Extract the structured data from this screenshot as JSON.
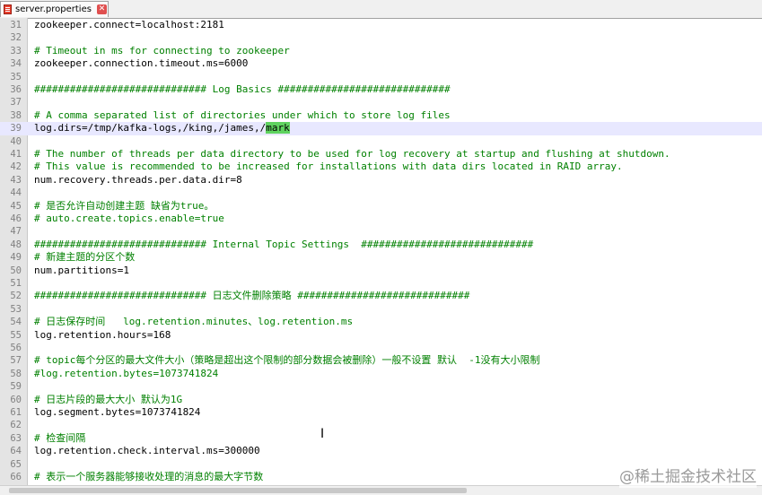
{
  "tab": {
    "title": "server.properties",
    "close_glyph": "✕"
  },
  "editor": {
    "lines": [
      {
        "n": "31",
        "parts": [
          {
            "t": "zookeeper.connect=localhost:2181"
          }
        ]
      },
      {
        "n": "32",
        "parts": []
      },
      {
        "n": "33",
        "parts": [
          {
            "t": "# Timeout in ms for connecting to zookeeper",
            "c": "comment"
          }
        ]
      },
      {
        "n": "34",
        "parts": [
          {
            "t": "zookeeper.connection.timeout.ms=6000"
          }
        ]
      },
      {
        "n": "35",
        "parts": []
      },
      {
        "n": "36",
        "parts": [
          {
            "t": "############################# Log Basics #############################",
            "c": "comment"
          }
        ]
      },
      {
        "n": "37",
        "parts": []
      },
      {
        "n": "38",
        "parts": [
          {
            "t": "# A comma separated list of directories under which to store log files",
            "c": "comment"
          }
        ]
      },
      {
        "n": "39",
        "current": true,
        "parts": [
          {
            "t": "log.dirs=/tmp/kafka-logs,/king,/james,/"
          },
          {
            "t": "mark",
            "c": "hl"
          }
        ]
      },
      {
        "n": "40",
        "parts": []
      },
      {
        "n": "41",
        "parts": [
          {
            "t": "# The number of threads per data directory to be used for log recovery at startup and flushing at shutdown.",
            "c": "comment"
          }
        ]
      },
      {
        "n": "42",
        "parts": [
          {
            "t": "# This value is recommended to be increased for installations with data dirs located in RAID array.",
            "c": "comment"
          }
        ]
      },
      {
        "n": "43",
        "parts": [
          {
            "t": "num.recovery.threads.per.data.dir=8"
          }
        ]
      },
      {
        "n": "44",
        "parts": []
      },
      {
        "n": "45",
        "parts": [
          {
            "t": "# 是否允许自动创建主题 缺省为true。",
            "c": "comment"
          }
        ]
      },
      {
        "n": "46",
        "parts": [
          {
            "t": "# auto.create.topics.enable=true",
            "c": "comment"
          }
        ]
      },
      {
        "n": "47",
        "parts": []
      },
      {
        "n": "48",
        "parts": [
          {
            "t": "############################# Internal Topic Settings  #############################",
            "c": "comment"
          }
        ]
      },
      {
        "n": "49",
        "parts": [
          {
            "t": "# 新建主题的分区个数",
            "c": "comment"
          }
        ]
      },
      {
        "n": "50",
        "parts": [
          {
            "t": "num.partitions=1"
          }
        ]
      },
      {
        "n": "51",
        "parts": []
      },
      {
        "n": "52",
        "parts": [
          {
            "t": "############################# 日志文件删除策略 #############################",
            "c": "comment"
          }
        ]
      },
      {
        "n": "53",
        "parts": []
      },
      {
        "n": "54",
        "parts": [
          {
            "t": "# 日志保存时间   log.retention.minutes、log.retention.ms",
            "c": "comment"
          }
        ]
      },
      {
        "n": "55",
        "parts": [
          {
            "t": "log.retention.hours=168"
          }
        ]
      },
      {
        "n": "56",
        "parts": []
      },
      {
        "n": "57",
        "parts": [
          {
            "t": "# topic每个分区的最大文件大小（策略是超出这个限制的部分数据会被删除）一般不设置 默认  -1没有大小限制",
            "c": "comment"
          }
        ]
      },
      {
        "n": "58",
        "parts": [
          {
            "t": "#log.retention.bytes=1073741824",
            "c": "comment"
          }
        ]
      },
      {
        "n": "59",
        "parts": []
      },
      {
        "n": "60",
        "parts": [
          {
            "t": "# 日志片段的最大大小 默认为1G",
            "c": "comment"
          }
        ]
      },
      {
        "n": "61",
        "parts": [
          {
            "t": "log.segment.bytes=1073741824"
          }
        ]
      },
      {
        "n": "62",
        "parts": []
      },
      {
        "n": "63",
        "parts": [
          {
            "t": "# 检查间隔",
            "c": "comment"
          }
        ]
      },
      {
        "n": "64",
        "parts": [
          {
            "t": "log.retention.check.interval.ms=300000"
          }
        ]
      },
      {
        "n": "65",
        "parts": []
      },
      {
        "n": "66",
        "parts": [
          {
            "t": "# 表示一个服务器能够接收处理的消息的最大字节数",
            "c": "comment"
          }
        ]
      }
    ]
  },
  "cursor_glyph": "I",
  "watermark": "@稀土掘金技术社区",
  "colors": {
    "comment": "#008000",
    "highlight": "#5fd35f",
    "current_line": "#e8e8ff",
    "gutter": "#e4e4e4"
  }
}
